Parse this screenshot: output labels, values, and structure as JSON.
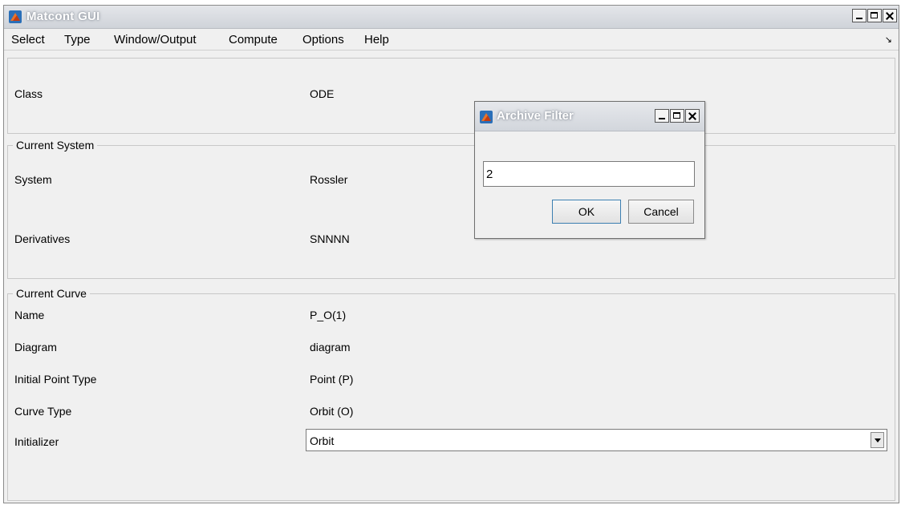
{
  "window": {
    "title": "Matcont GUI"
  },
  "menu": [
    "Select",
    "Type",
    "Window/Output",
    "Compute",
    "Options",
    "Help"
  ],
  "menu_corner_icon": "dock-arrow-icon",
  "class_panel": {
    "label": "Class",
    "value": "ODE"
  },
  "system_panel": {
    "legend": "Current System",
    "system_label": "System",
    "system_value": "Rossler",
    "derivatives_label": "Derivatives",
    "derivatives_value": "SNNNN"
  },
  "curve_panel": {
    "legend": "Current Curve",
    "rows": [
      {
        "label": "Name",
        "value": "P_O(1)"
      },
      {
        "label": "Diagram",
        "value": "diagram"
      },
      {
        "label": "Initial Point Type",
        "value": "Point (P)"
      },
      {
        "label": "Curve Type",
        "value": "Orbit (O)"
      }
    ],
    "initializer_label": "Initializer",
    "initializer_value": "Orbit"
  },
  "dialog": {
    "title": "Archive Filter",
    "input_value": "2",
    "ok_label": "OK",
    "cancel_label": "Cancel"
  }
}
